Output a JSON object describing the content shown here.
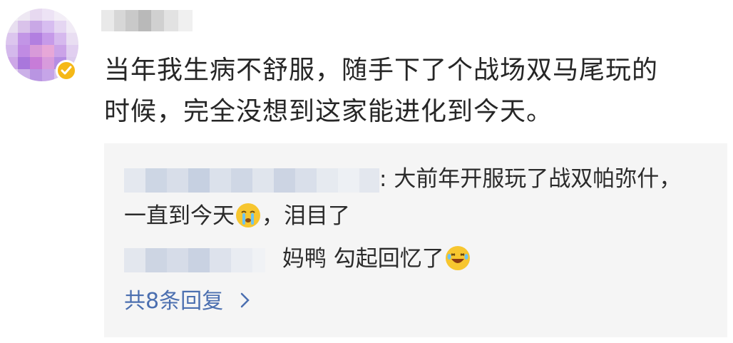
{
  "comment": {
    "line1": "当年我生病不舒服，随手下了个战场双马尾玩的",
    "line2": "时候，完全没想到这家能进化到今天。"
  },
  "replies": [
    {
      "separator": ": ",
      "text_line1": "大前年开服玩了战双帕弥什，",
      "text_line2_a": "一直到今天",
      "emoji": "crying-face-icon",
      "text_line2_b": "，泪目了"
    },
    {
      "text_a": "妈鸭 勾起回忆了",
      "emoji": "laughing-face-icon"
    }
  ],
  "more_replies": {
    "label": "共8条回复",
    "arrow": "›"
  },
  "colors": {
    "text": "#262626",
    "link": "#4b6fb0",
    "reply_bg": "#f5f5f5",
    "badge": "#f5b817"
  }
}
